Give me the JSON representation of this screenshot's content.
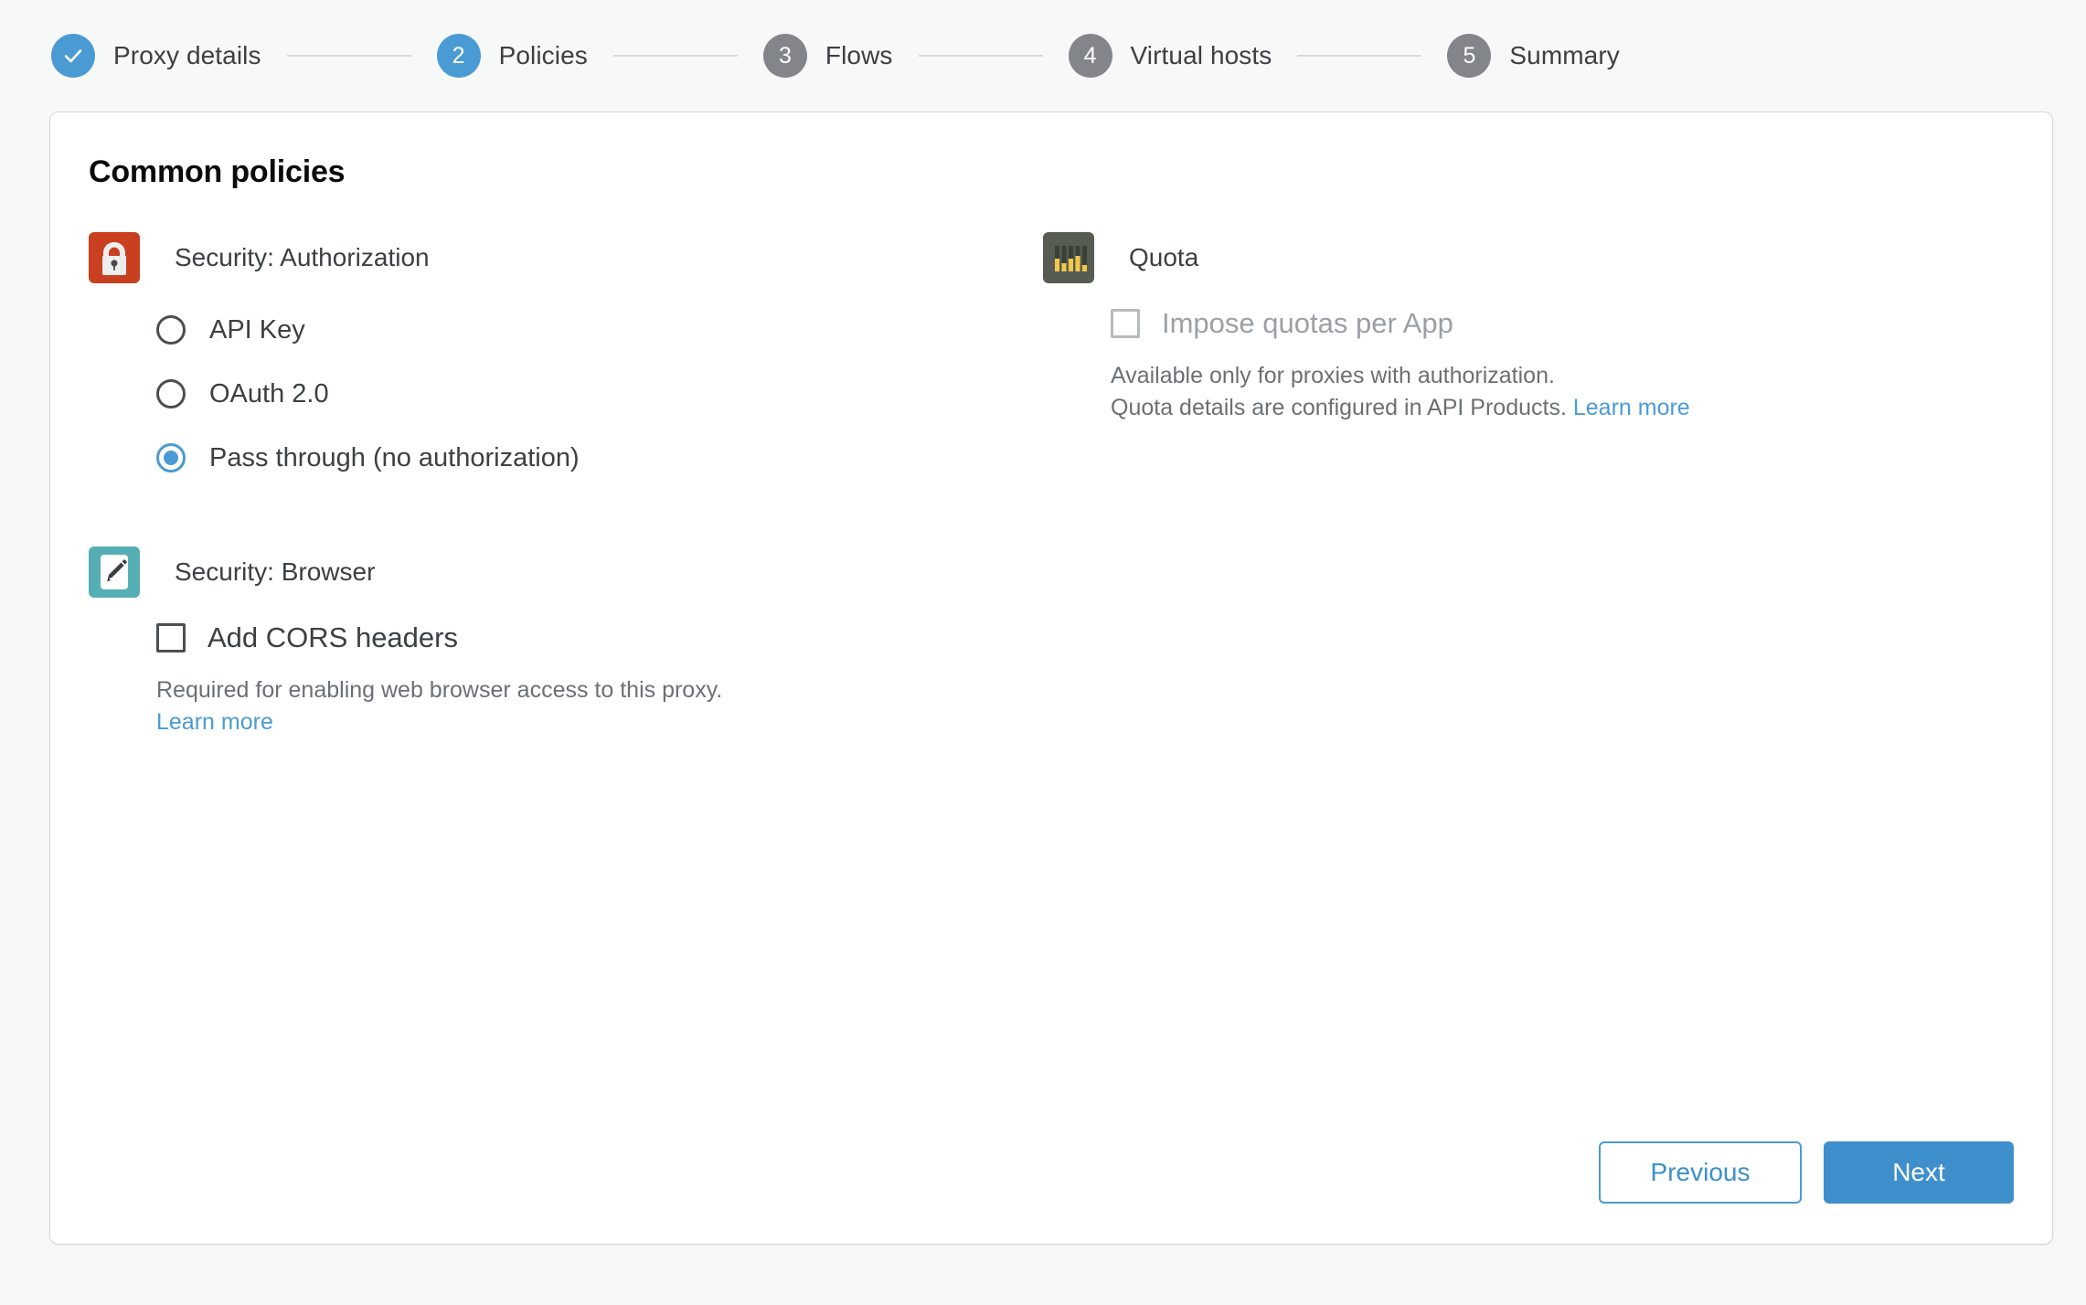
{
  "stepper": {
    "steps": [
      {
        "badge": "check-icon",
        "number": "",
        "label": "Proxy details",
        "state": "done"
      },
      {
        "badge": "number",
        "number": "2",
        "label": "Policies",
        "state": "active"
      },
      {
        "badge": "number",
        "number": "3",
        "label": "Flows",
        "state": "todo"
      },
      {
        "badge": "number",
        "number": "4",
        "label": "Virtual hosts",
        "state": "todo"
      },
      {
        "badge": "number",
        "number": "5",
        "label": "Summary",
        "state": "todo"
      }
    ]
  },
  "card": {
    "title": "Common policies"
  },
  "authorization": {
    "icon": "lock-icon",
    "title": "Security: Authorization",
    "options": [
      {
        "label": "API Key",
        "selected": false
      },
      {
        "label": "OAuth 2.0",
        "selected": false
      },
      {
        "label": "Pass through (no authorization)",
        "selected": true
      }
    ]
  },
  "browser": {
    "icon": "pencil-icon",
    "title": "Security: Browser",
    "checkbox_label": "Add CORS headers",
    "checked": false,
    "help_line1": "Required for enabling web browser access to this proxy.",
    "learn_more": "Learn more"
  },
  "quota": {
    "icon": "bar-chart-icon",
    "title": "Quota",
    "checkbox_label": "Impose quotas per App",
    "checked": false,
    "disabled": true,
    "help_line1": "Available only for proxies with authorization.",
    "help_line2": "Quota details are configured in API Products.",
    "learn_more": "Learn more"
  },
  "footer": {
    "previous_label": "Previous",
    "next_label": "Next"
  },
  "colors": {
    "accent_blue": "#4a9bd4",
    "primary_button": "#3e8fcc",
    "step_todo_gray": "#82868a",
    "lock_icon_bg": "#c8401f",
    "pencil_icon_bg": "#55aeb3",
    "quota_icon_bg": "#565c52",
    "quota_bar_yellow": "#f5c748",
    "page_bg": "#f7f8f8",
    "card_bg": "#ffffff",
    "card_border": "#d5d7d9",
    "text_primary": "#3c4043",
    "text_muted": "#6b7074",
    "text_disabled": "#9aa0a5"
  }
}
